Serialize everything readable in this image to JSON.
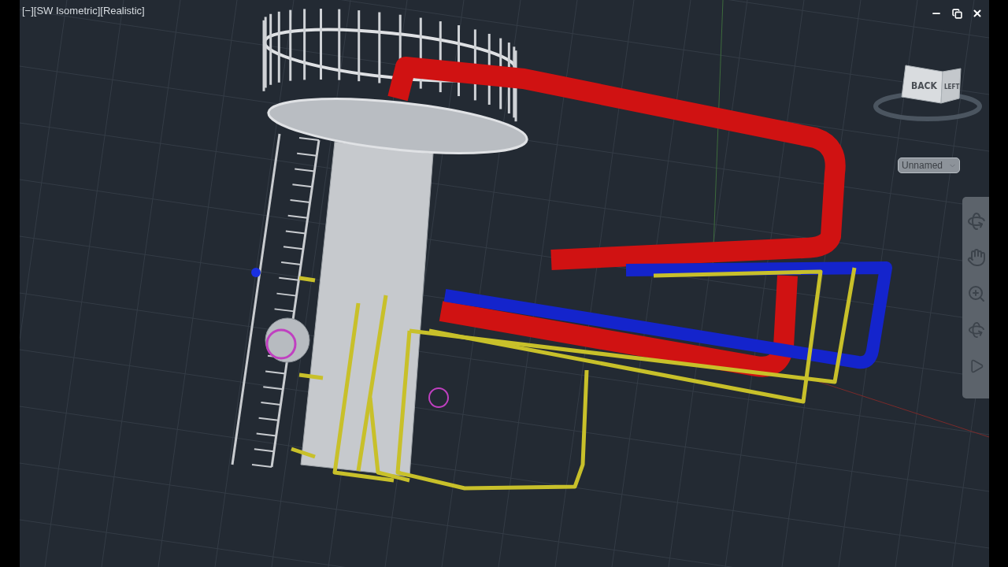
{
  "viewport": {
    "label": "[−][SW Isometric][Realistic]"
  },
  "viewcube": {
    "faces": [
      "BACK",
      "LEFT"
    ]
  },
  "named_view": {
    "value": "Unnamed"
  }
}
